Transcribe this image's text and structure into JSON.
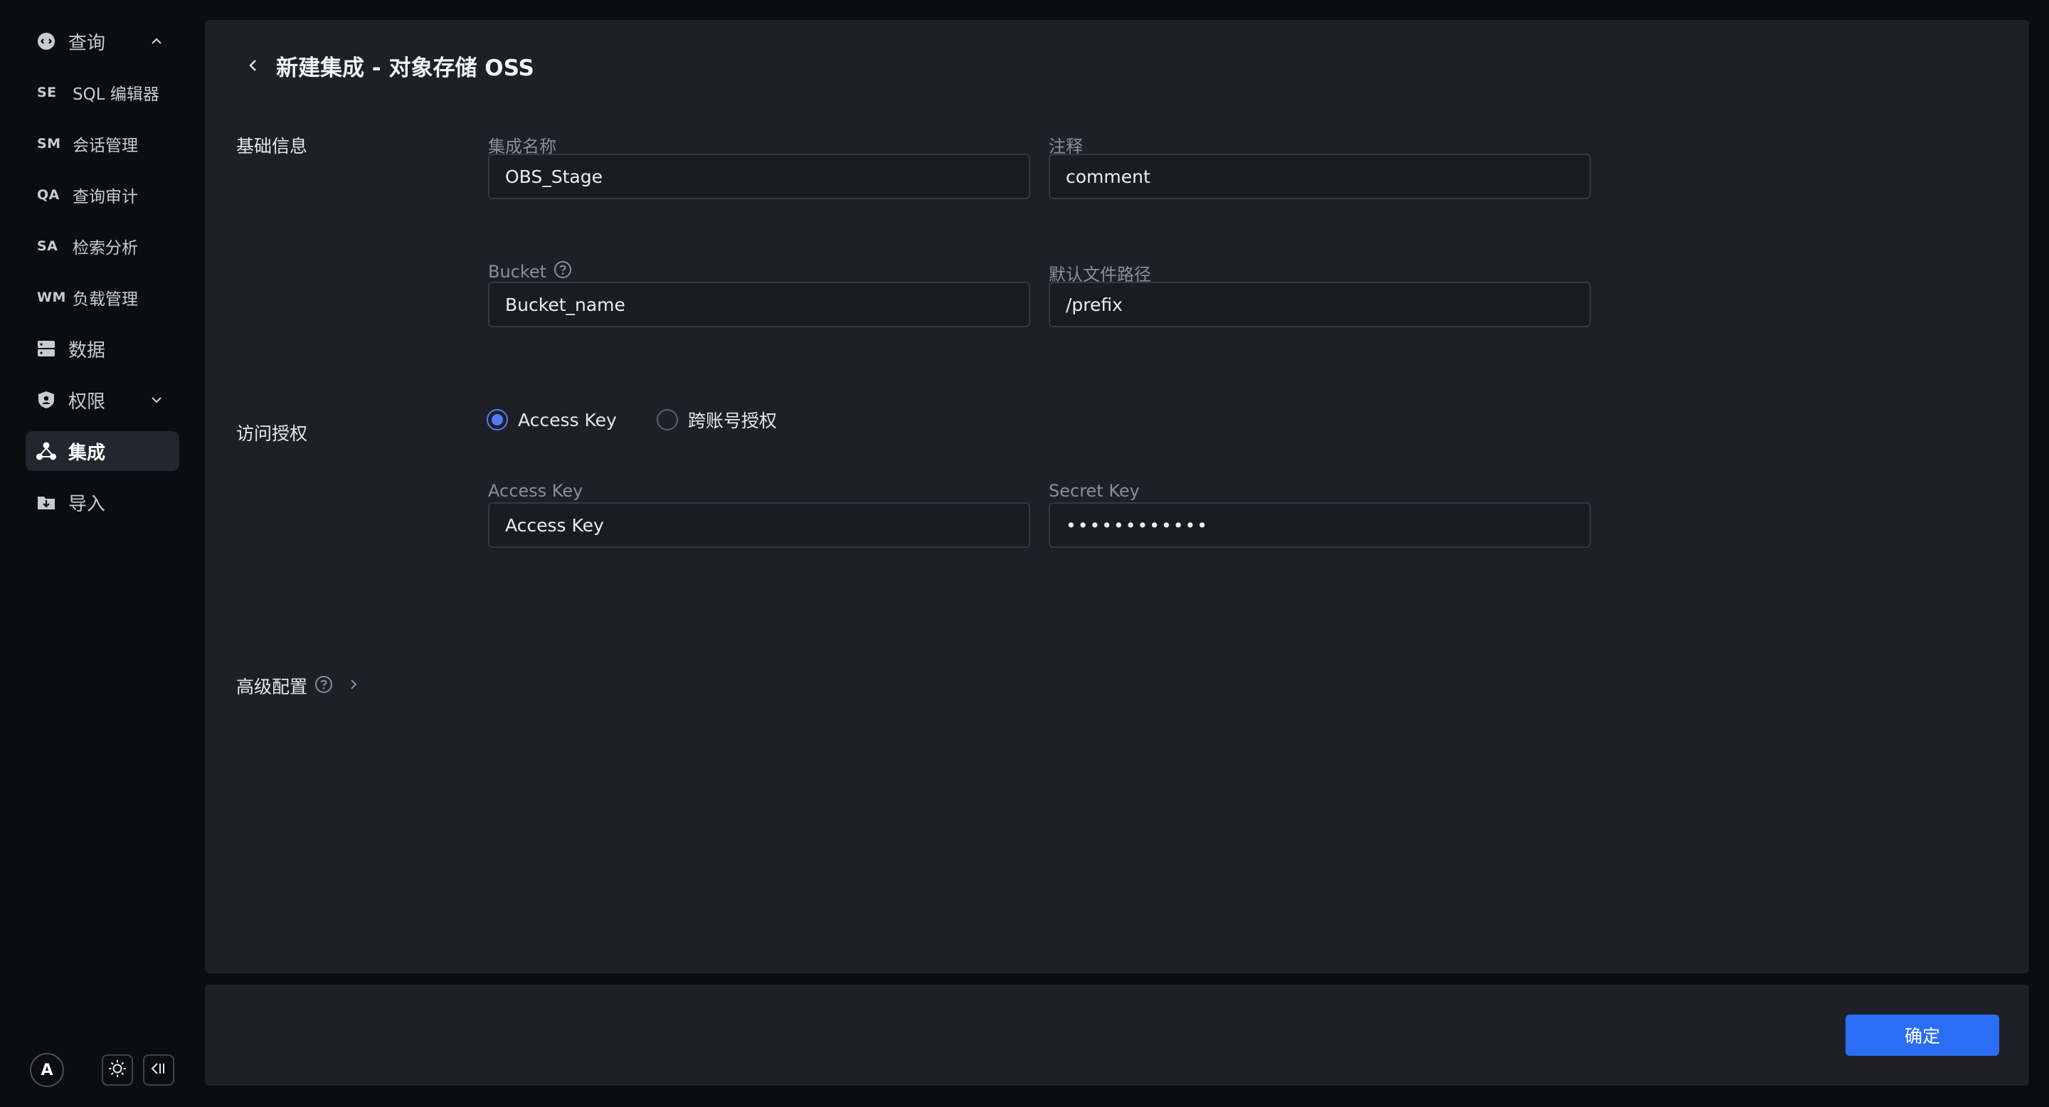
{
  "sidebar": {
    "query": {
      "label": "查询",
      "icon": "query-icon",
      "expanded": true
    },
    "sub_items": [
      {
        "abbr": "SE",
        "label": "SQL 编辑器"
      },
      {
        "abbr": "SM",
        "label": "会话管理"
      },
      {
        "abbr": "QA",
        "label": "查询审计"
      },
      {
        "abbr": "SA",
        "label": "检索分析"
      },
      {
        "abbr": "WM",
        "label": "负载管理"
      }
    ],
    "data": {
      "label": "数据",
      "icon": "database-icon"
    },
    "permissions": {
      "label": "权限",
      "icon": "shield-user-icon"
    },
    "integration": {
      "label": "集成",
      "icon": "integration-icon",
      "active": true
    },
    "import": {
      "label": "导入",
      "icon": "folder-import-icon"
    },
    "avatar": "A"
  },
  "header": {
    "title": "新建集成 - 对象存储 OSS"
  },
  "sections": {
    "basic": "基础信息",
    "access": "访问授权",
    "advanced": "高级配置"
  },
  "fields": {
    "name": {
      "label": "集成名称",
      "value": "OBS_Stage"
    },
    "comment": {
      "label": "注释",
      "value": "comment"
    },
    "bucket": {
      "label": "Bucket",
      "value": "Bucket_name"
    },
    "path": {
      "label": "默认文件路径",
      "value": "/prefix"
    },
    "access_key": {
      "label": "Access Key",
      "value": "Access Key"
    },
    "secret_key": {
      "label": "Secret Key",
      "value": "••••••••••••"
    }
  },
  "auth_options": [
    {
      "label": "Access Key",
      "checked": true
    },
    {
      "label": "跨账号授权",
      "checked": false
    }
  ],
  "footer": {
    "confirm_label": "确定"
  },
  "colors": {
    "accent": "#2b6ef5",
    "radio": "#4f7df7",
    "background": "#0c0d12",
    "panel": "#1f2027"
  }
}
